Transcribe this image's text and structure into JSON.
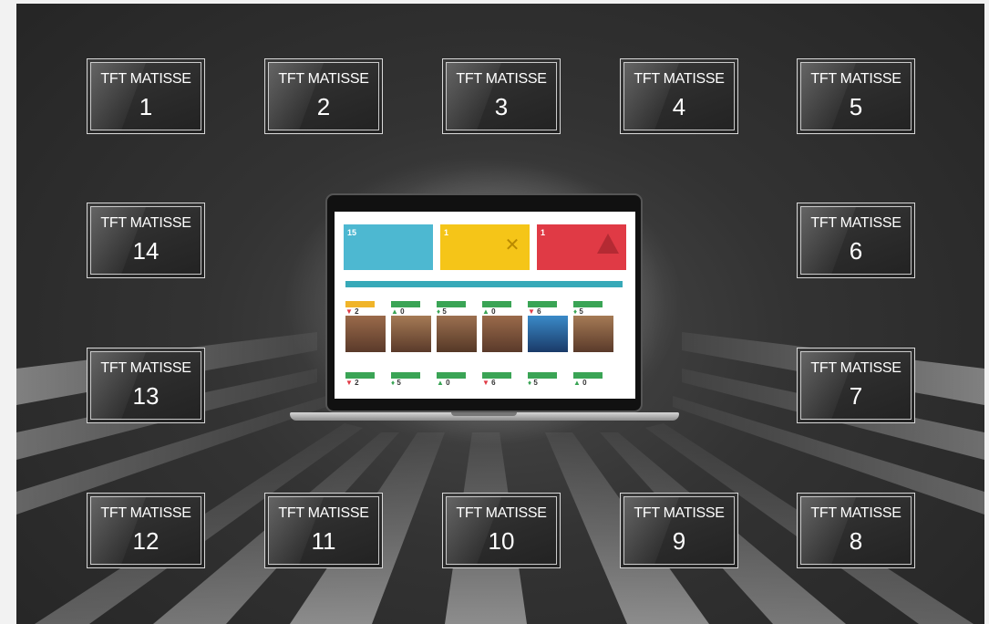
{
  "tiles": [
    {
      "line1": "TFT MATISSE",
      "num": "1"
    },
    {
      "line1": "TFT MATISSE",
      "num": "2"
    },
    {
      "line1": "TFT MATISSE",
      "num": "3"
    },
    {
      "line1": "TFT MATISSE",
      "num": "4"
    },
    {
      "line1": "TFT MATISSE",
      "num": "5"
    },
    {
      "line1": "TFT MATISSE",
      "num": "14"
    },
    {
      "line1": "TFT MATISSE",
      "num": "6"
    },
    {
      "line1": "TFT MATISSE",
      "num": "13"
    },
    {
      "line1": "TFT MATISSE",
      "num": "7"
    },
    {
      "line1": "TFT MATISSE",
      "num": "12"
    },
    {
      "line1": "TFT MATISSE",
      "num": "11"
    },
    {
      "line1": "TFT MATISSE",
      "num": "10"
    },
    {
      "line1": "TFT MATISSE",
      "num": "9"
    },
    {
      "line1": "TFT MATISSE",
      "num": "8"
    }
  ],
  "dashboard": {
    "cards": [
      {
        "value": "15",
        "color": "#4db8d1"
      },
      {
        "value": "1",
        "color": "#f5c518"
      },
      {
        "value": "1",
        "color": "#e03a45"
      }
    ],
    "row1": [
      {
        "arrow": "▼",
        "arrow_color": "#e03a45",
        "value": "2",
        "badge": "#f0b429",
        "img": "#7a4a3a"
      },
      {
        "arrow": "▲",
        "arrow_color": "#3aa455",
        "value": "0",
        "badge": "#3aa455",
        "img": "#8a5a3a"
      },
      {
        "arrow": "♦",
        "arrow_color": "#3aa455",
        "value": "5",
        "badge": "#3aa455",
        "img": "#805a44"
      },
      {
        "arrow": "▲",
        "arrow_color": "#3aa455",
        "value": "0",
        "badge": "#3aa455",
        "img": "#7a4a3a"
      },
      {
        "arrow": "▼",
        "arrow_color": "#e03a45",
        "value": "6",
        "badge": "#3aa455",
        "img": "#2a6aa8"
      },
      {
        "arrow": "♦",
        "arrow_color": "#3aa455",
        "value": "5",
        "badge": "#3aa455",
        "img": "#8a5a3a"
      }
    ],
    "row2": [
      {
        "arrow": "▼",
        "arrow_color": "#e03a45",
        "value": "2",
        "badge": "#3aa455"
      },
      {
        "arrow": "♦",
        "arrow_color": "#3aa455",
        "value": "5",
        "badge": "#3aa455"
      },
      {
        "arrow": "▲",
        "arrow_color": "#3aa455",
        "value": "0",
        "badge": "#3aa455"
      },
      {
        "arrow": "▼",
        "arrow_color": "#e03a45",
        "value": "6",
        "badge": "#3aa455"
      },
      {
        "arrow": "♦",
        "arrow_color": "#3aa455",
        "value": "5",
        "badge": "#3aa455"
      },
      {
        "arrow": "▲",
        "arrow_color": "#3aa455",
        "value": "0",
        "badge": "#3aa455"
      }
    ]
  }
}
